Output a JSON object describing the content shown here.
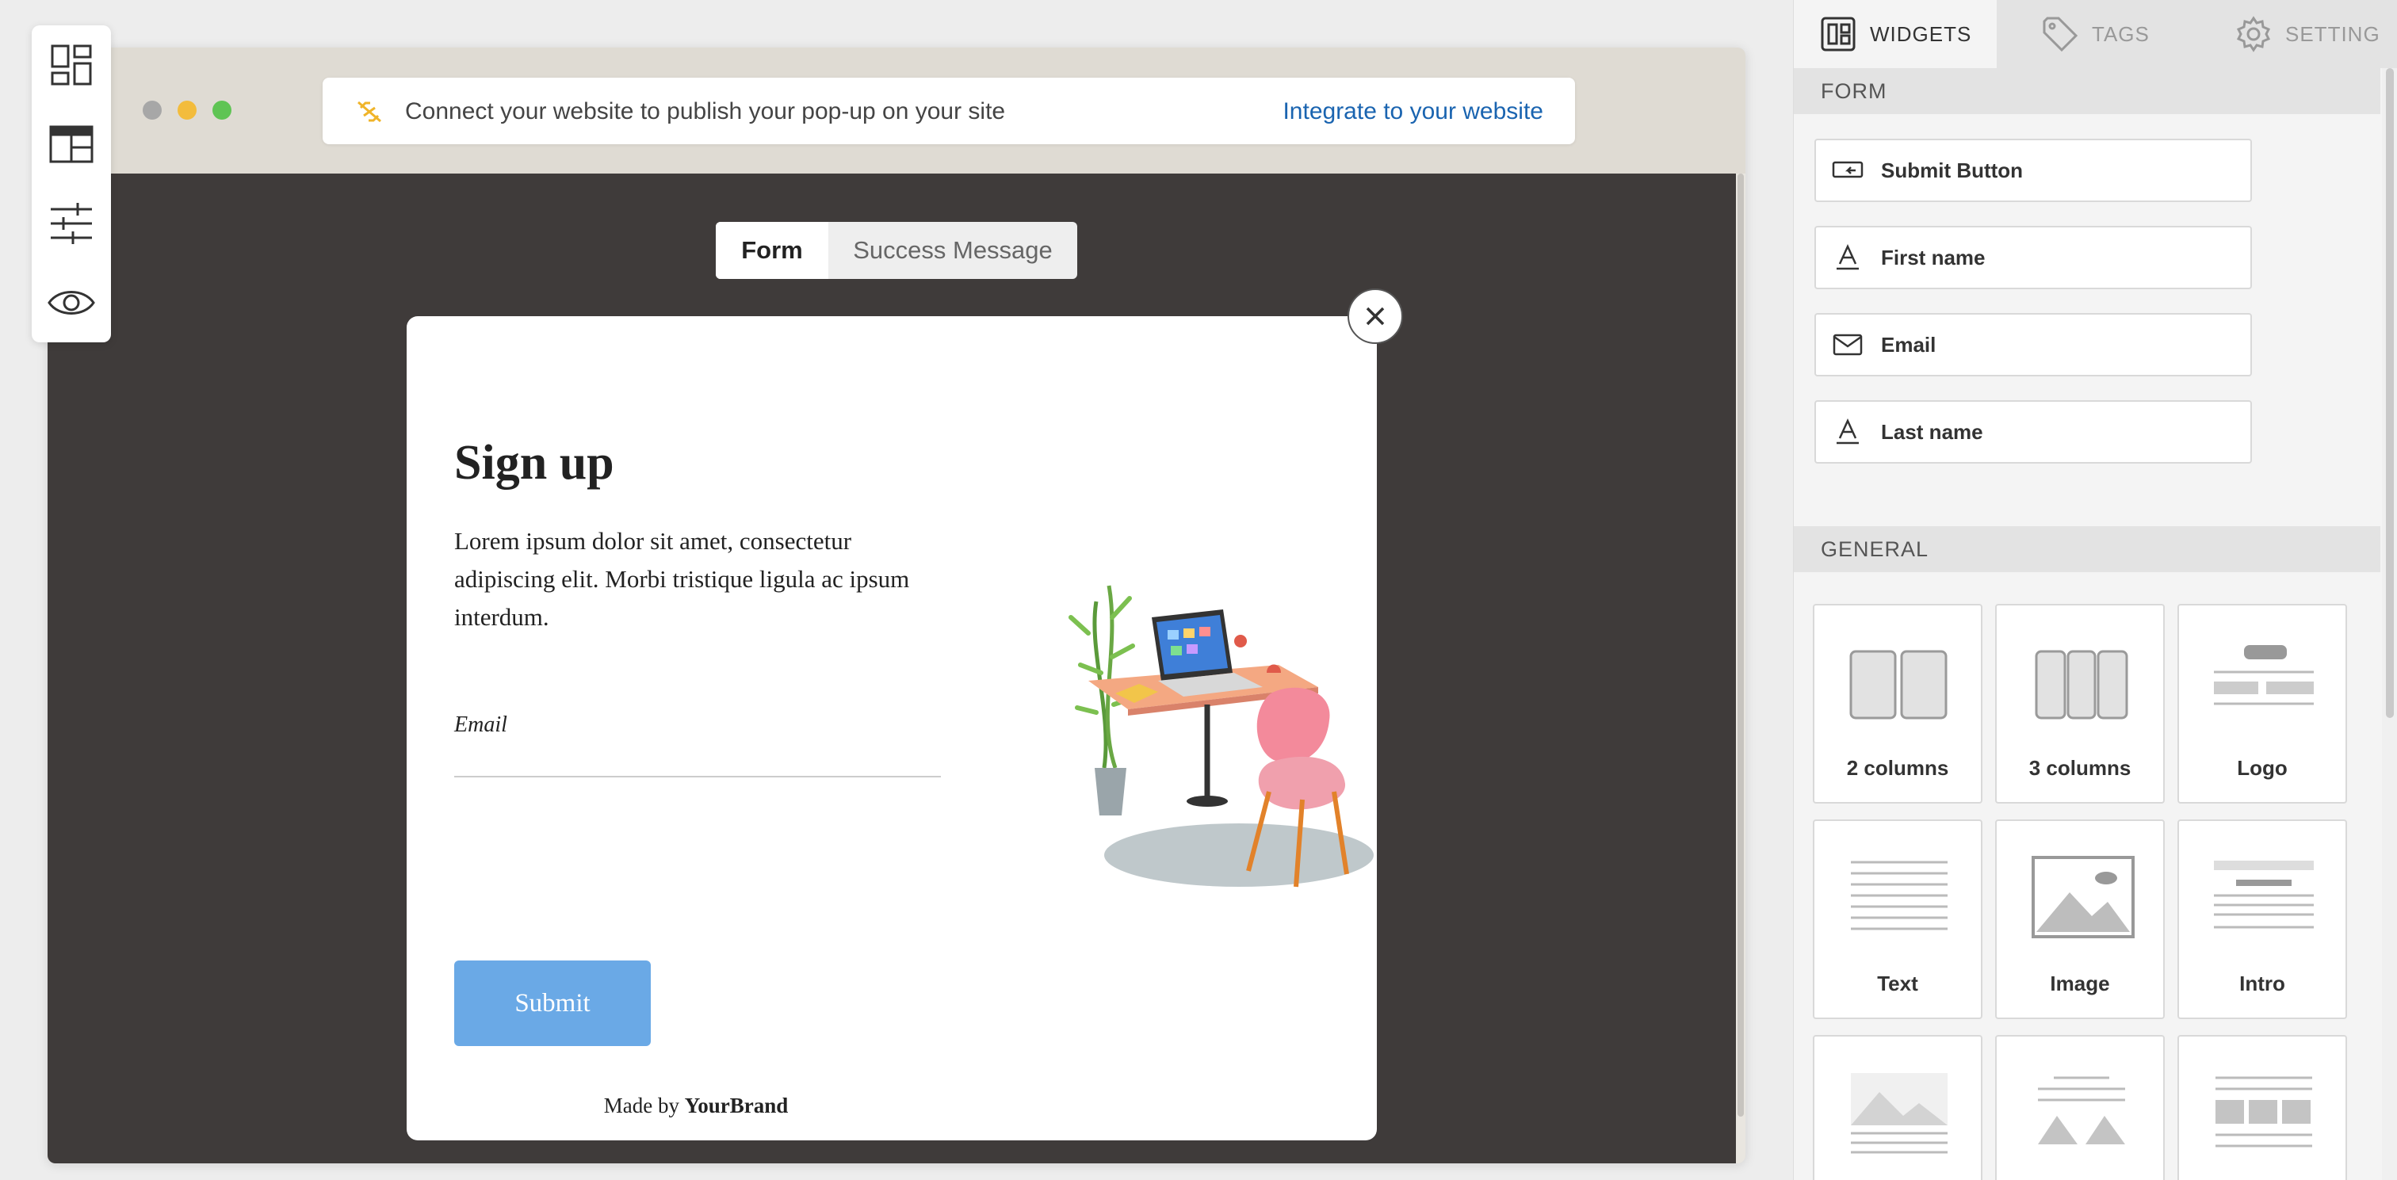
{
  "toolbar": {
    "icons": [
      "widgets-grid-icon",
      "layout-icon",
      "sliders-icon",
      "eye-icon"
    ]
  },
  "browser": {
    "address_notice": "Connect your website to publish your pop-up on your site",
    "address_link": "Integrate to your website",
    "dots": [
      "#a7a7a7",
      "#f3bc3c",
      "#5fc454"
    ]
  },
  "editor": {
    "tabs": [
      "Form",
      "Success Message"
    ],
    "active_tab": "Form"
  },
  "popup": {
    "title": "Sign up",
    "body": "Lorem ipsum dolor sit amet, consectetur adipiscing elit. Morbi tristique ligula ac ipsum interdum.",
    "email_label": "Email",
    "submit_label": "Submit",
    "footer_prefix": "Made by",
    "footer_brand": "YourBrand",
    "submit_color": "#6aa9e6"
  },
  "panel": {
    "tabs": [
      {
        "label": "WIDGETS",
        "icon": "widgets-icon",
        "active": true
      },
      {
        "label": "TAGS",
        "icon": "tag-icon",
        "active": false
      },
      {
        "label": "SETTING",
        "icon": "gear-icon",
        "active": false
      }
    ],
    "form_section": "FORM",
    "form_fields": [
      {
        "label": "Submit Button",
        "icon": "submit-button-icon"
      },
      {
        "label": "First name",
        "icon": "text-field-icon"
      },
      {
        "label": "Email",
        "icon": "mail-icon"
      },
      {
        "label": "Last name",
        "icon": "text-field-icon"
      }
    ],
    "general_section": "GENERAL",
    "general_widgets": [
      "2 columns",
      "3 columns",
      "Logo",
      "Text",
      "Image",
      "Intro"
    ]
  }
}
